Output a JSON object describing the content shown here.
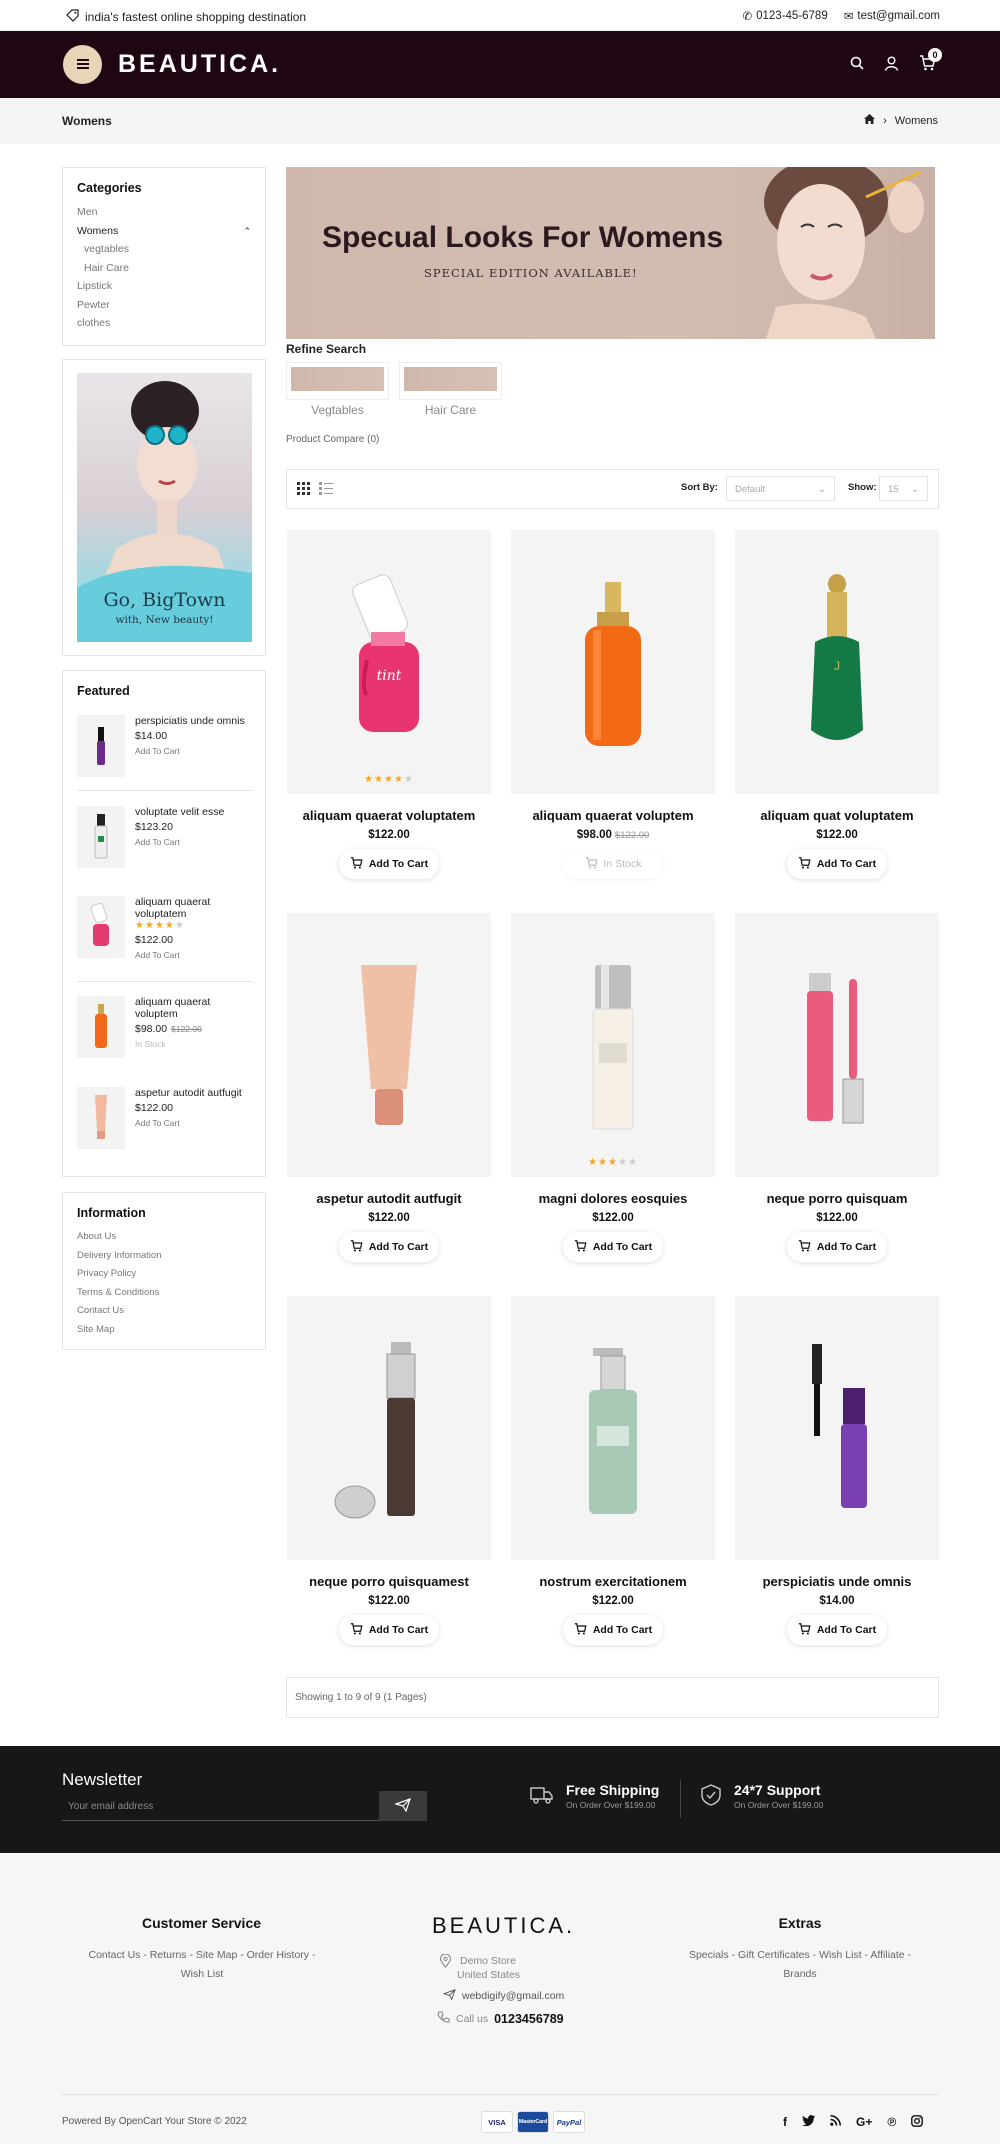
{
  "top": {
    "tagline": "india's fastest online shopping destination",
    "phone": "0123-45-6789",
    "email": "test@gmail.com"
  },
  "header": {
    "logo": "BEAUTICA.",
    "cart_count": "0"
  },
  "breadcrumb": {
    "title": "Womens",
    "current": "Womens"
  },
  "categories": {
    "title": "Categories",
    "items": [
      "Men",
      "Womens",
      "vegtables",
      "Hair Care",
      "Lipstick",
      "Pewter",
      "clothes"
    ]
  },
  "side_banner": {
    "line1": "Go, BigTown",
    "line2": "with, New beauty!"
  },
  "featured": {
    "title": "Featured",
    "items": [
      {
        "name": "perspiciatis unde omnis",
        "price": "$14.00",
        "action": "Add To Cart"
      },
      {
        "name": "voluptate velit esse",
        "price": "$123.20",
        "action": "Add To Cart"
      },
      {
        "name": "aliquam quaerat voluptatem",
        "price": "$122.00",
        "action": "Add To Cart",
        "rating": 4
      },
      {
        "name": "aliquam quaerat voluptem",
        "price": "$98.00",
        "old_price": "$122.00",
        "action": "In Stock"
      },
      {
        "name": "aspetur autodit autfugit",
        "price": "$122.00",
        "action": "Add To Cart"
      }
    ]
  },
  "information": {
    "title": "Information",
    "items": [
      "About Us",
      "Delivery Information",
      "Privacy Policy",
      "Terms & Conditions",
      "Contact Us",
      "Site Map"
    ]
  },
  "banner": {
    "heading": "Specual Looks For Womens",
    "sub": "SPECIAL EDITION AVAILABLE!"
  },
  "refine": {
    "title": "Refine Search",
    "items": [
      "Vegtables",
      "Hair Care"
    ]
  },
  "compare": "Product Compare (0)",
  "toolbar": {
    "sort_label": "Sort By:",
    "sort_value": "Default",
    "show_label": "Show:",
    "show_value": "15"
  },
  "products": [
    {
      "name": "aliquam quaerat voluptatem",
      "price": "$122.00",
      "action": "Add To Cart",
      "rating": 4
    },
    {
      "name": "aliquam quaerat voluptem",
      "price": "$98.00",
      "old_price": "$122.00",
      "action": "In Stock"
    },
    {
      "name": "aliquam quat voluptatem",
      "price": "$122.00",
      "action": "Add To Cart"
    },
    {
      "name": "aspetur autodit autfugit",
      "price": "$122.00",
      "action": "Add To Cart"
    },
    {
      "name": "magni dolores eosquies",
      "price": "$122.00",
      "action": "Add To Cart",
      "rating": 3
    },
    {
      "name": "neque porro quisquam",
      "price": "$122.00",
      "action": "Add To Cart"
    },
    {
      "name": "neque porro quisquamest",
      "price": "$122.00",
      "action": "Add To Cart"
    },
    {
      "name": "nostrum exercitationem",
      "price": "$122.00",
      "action": "Add To Cart"
    },
    {
      "name": "perspiciatis unde omnis",
      "price": "$14.00",
      "action": "Add To Cart"
    }
  ],
  "showing": "Showing 1 to 9 of 9 (1 Pages)",
  "newsletter": {
    "title": "Newsletter",
    "placeholder": "Your email address"
  },
  "features": [
    {
      "title": "Free Shipping",
      "sub": "On Order Over $199.00"
    },
    {
      "title": "24*7 Support",
      "sub": "On Order Over $199.00"
    }
  ],
  "footer": {
    "customer_service": {
      "title": "Customer Service",
      "links_line1": "Contact Us  -  Returns  -  Site Map  -  Order History  -",
      "links_line2": "Wish List"
    },
    "logo": "BEAUTICA.",
    "address_line1": "Demo Store",
    "address_line2": "United States",
    "email": "webdigify@gmail.com",
    "call_label": "Call us",
    "call_number": "0123456789",
    "extras": {
      "title": "Extras",
      "links_line1": "Specials  -  Gift Certificates  -  Wish List  -  Affiliate  -",
      "links_line2": "Brands"
    },
    "powered": "Powered By OpenCart Your Store © 2022",
    "payments": [
      "VISA",
      "MasterCard",
      "PayPal"
    ]
  }
}
